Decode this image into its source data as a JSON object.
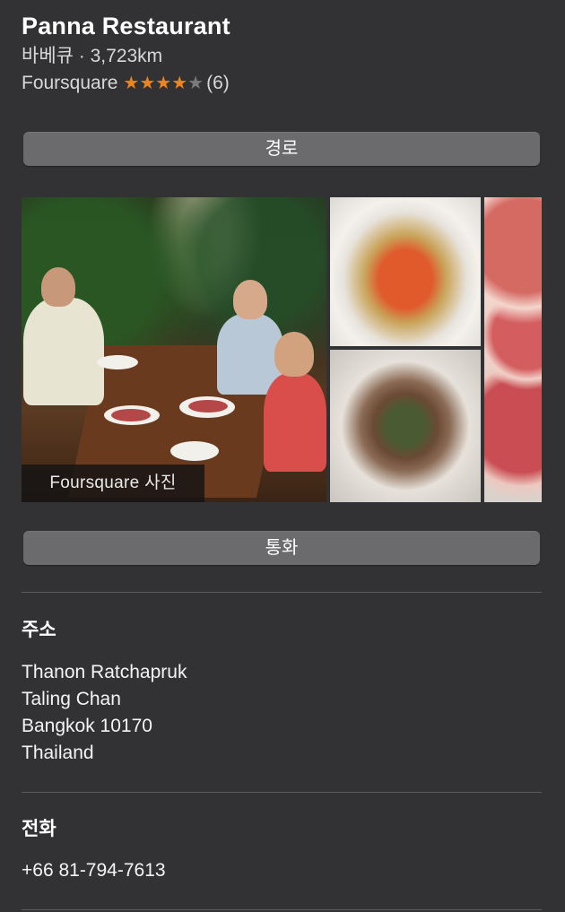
{
  "place": {
    "name": "Panna Restaurant",
    "subtitle": "바베큐 · 3,723km",
    "rating_source": "Foursquare",
    "rating_stars": 4,
    "rating_max": 5,
    "rating_count": "(6)"
  },
  "actions": {
    "directions_label": "경로",
    "call_label": "통화"
  },
  "gallery": {
    "caption": "Foursquare 사진"
  },
  "address": {
    "heading": "주소",
    "lines": [
      "Thanon Ratchapruk",
      "Taling Chan",
      "Bangkok 10170",
      "Thailand"
    ]
  },
  "phone": {
    "heading": "전화",
    "number": "+66 81-794-7613"
  },
  "colors": {
    "background": "#323234",
    "button": "#6b6b6d",
    "star_full": "#f0831a",
    "star_empty": "#7b7b7b"
  }
}
